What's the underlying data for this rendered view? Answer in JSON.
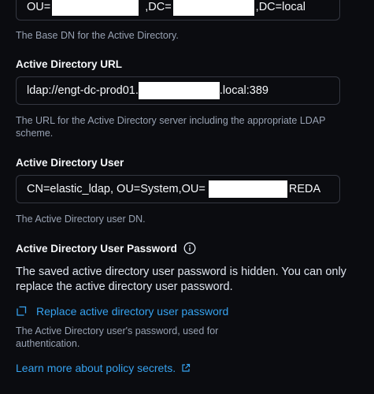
{
  "base_dn": {
    "value_part1": "OU=",
    "value_part2": ",DC=",
    "value_part3": ",DC=local",
    "help": "The Base DN for the Active Directory."
  },
  "ad_url": {
    "label": "Active Directory URL",
    "value_part1": "ldap://engt-dc-prod01.",
    "value_part2": ".local:389",
    "help": "The URL for the Active Directory server including the appropriate LDAP scheme."
  },
  "ad_user": {
    "label": "Active Directory User",
    "value_part1": "CN=elastic_ldap, OU=System,OU=",
    "value_part2": "REDA",
    "help": "The Active Directory user DN."
  },
  "ad_password": {
    "label": "Active Directory User Password",
    "info_icon": "info-icon",
    "notice": "The saved active directory user password is hidden. You can only replace the active directory user password.",
    "replace_link": "Replace active directory user password",
    "replace_icon": "replace-icon",
    "help": "The Active Directory user's password, used for authentication."
  },
  "learn_more": {
    "label": "Learn more about policy secrets.",
    "icon": "external-link-icon"
  },
  "colors": {
    "background": "#0b0c10",
    "link": "#36a2ef",
    "help_text": "#98a2b3",
    "border": "#343741"
  }
}
